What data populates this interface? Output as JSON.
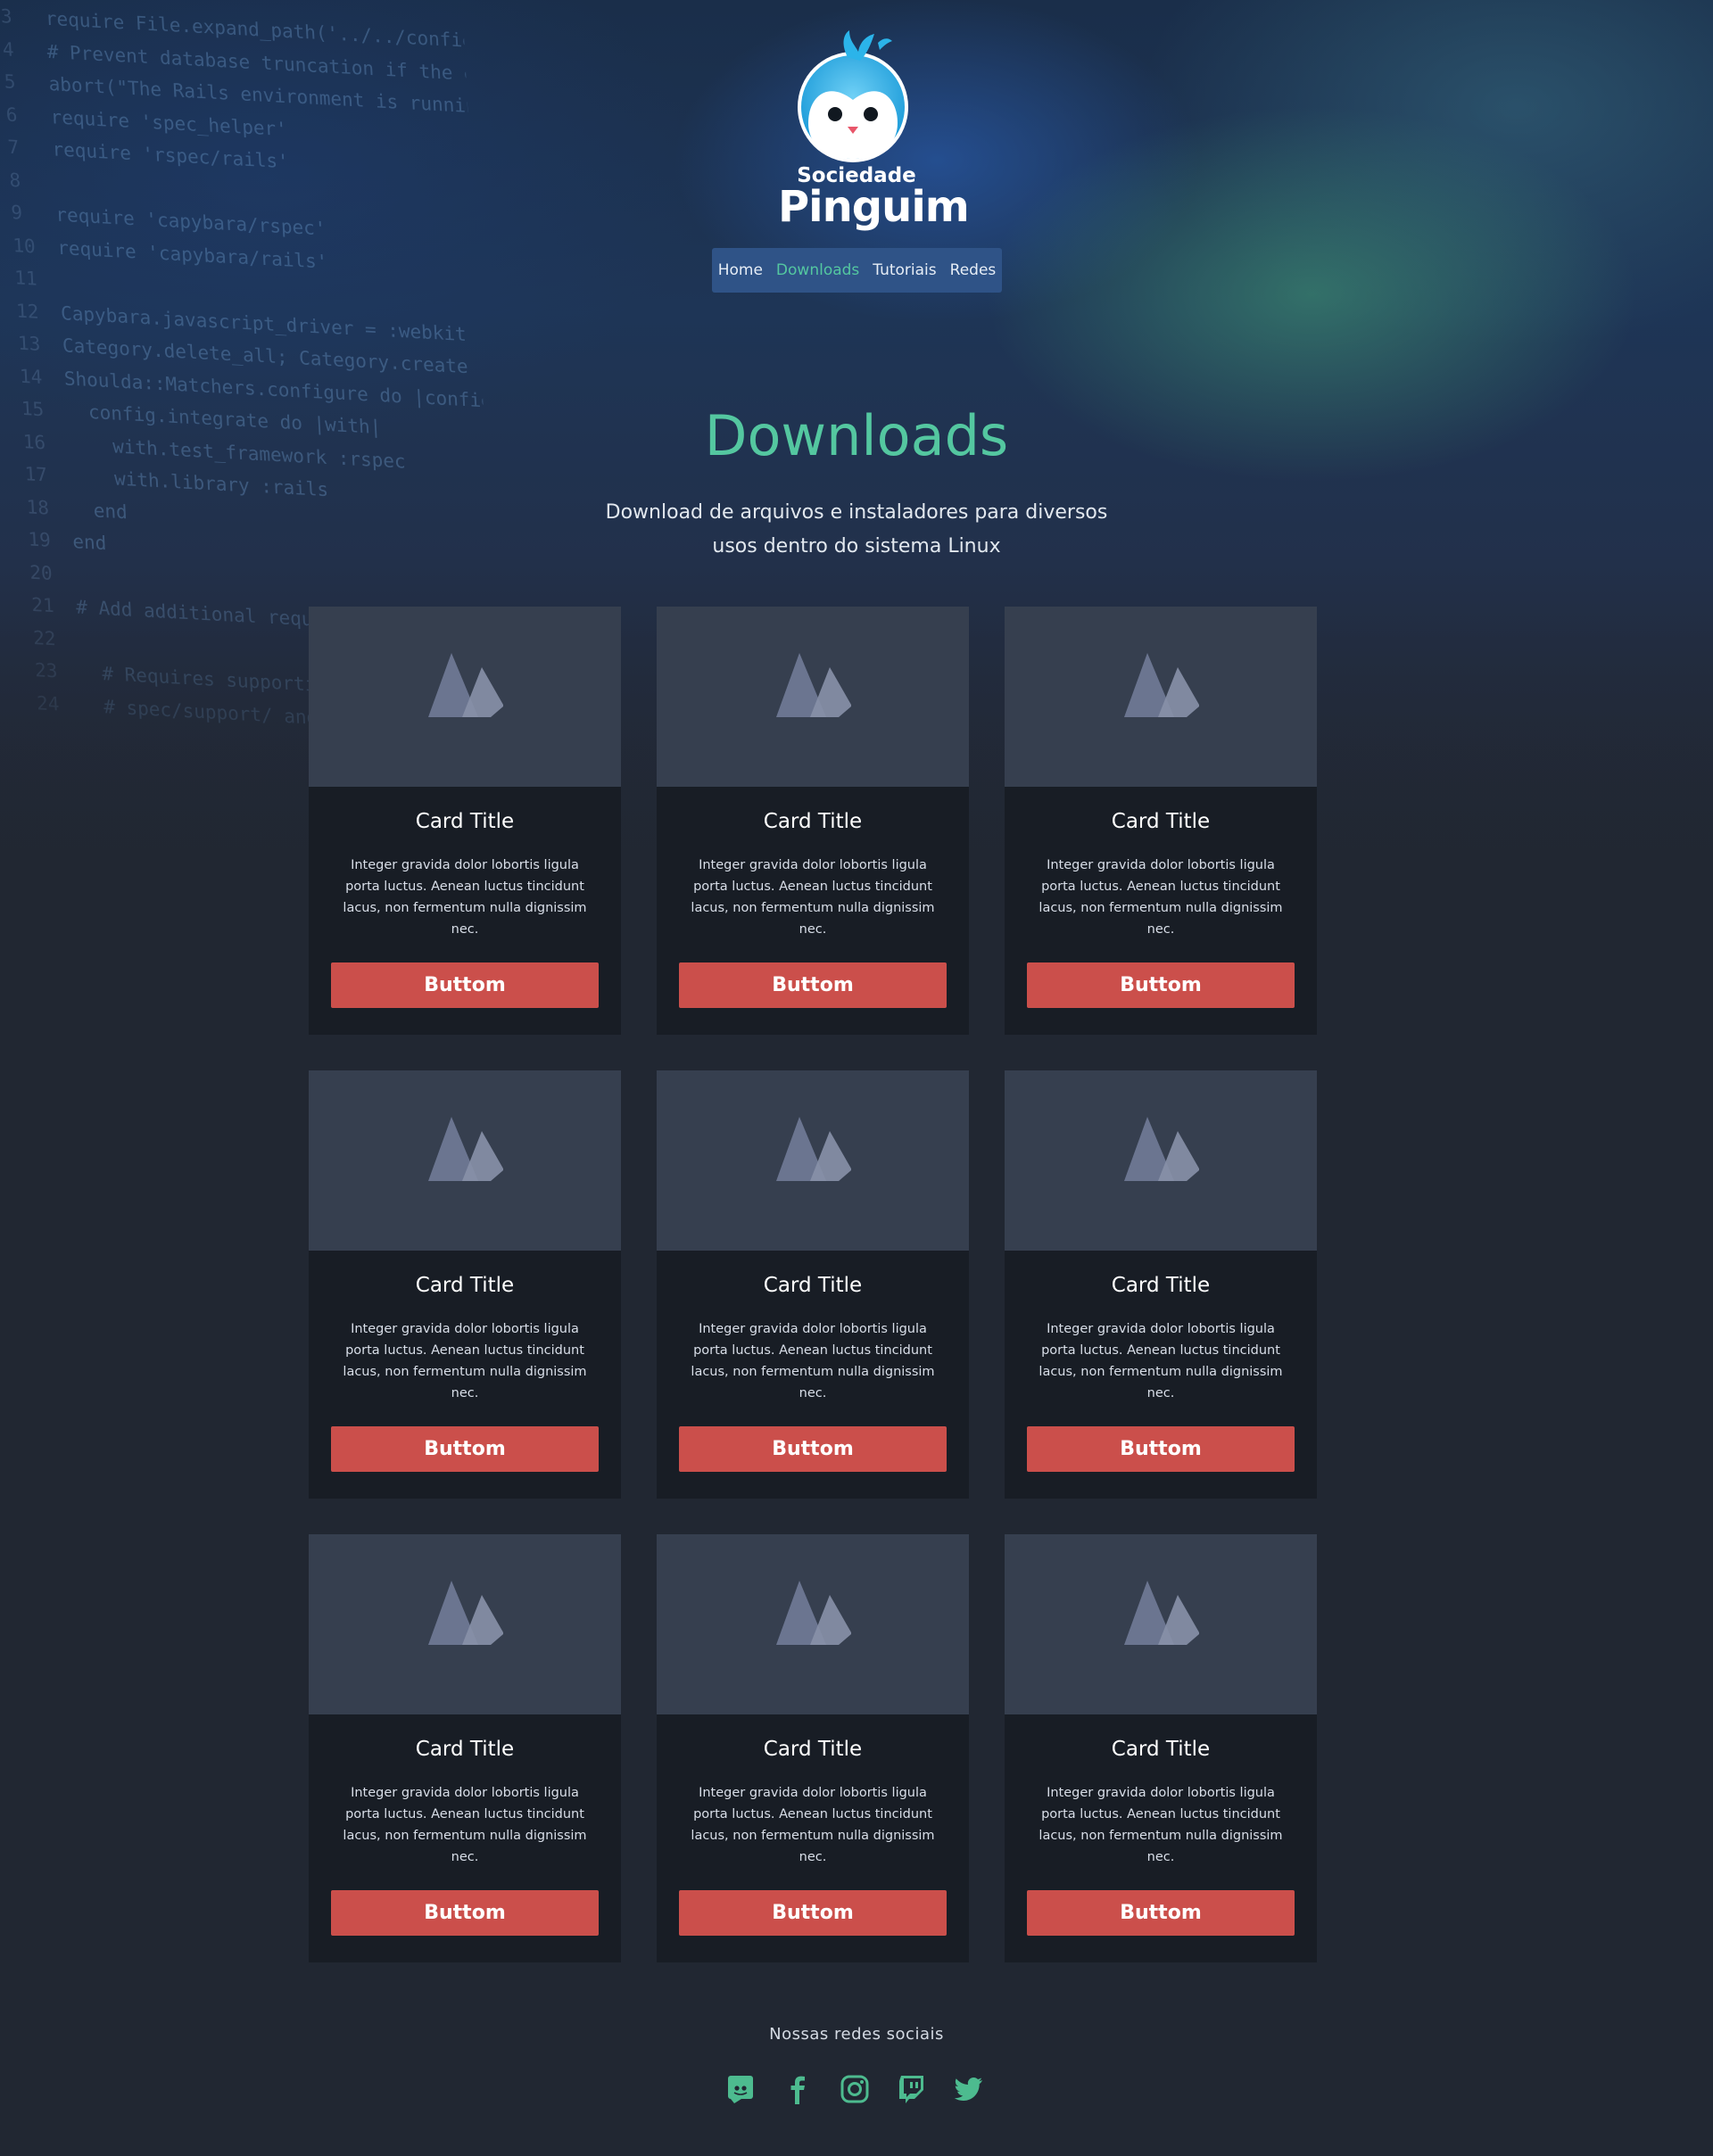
{
  "brand": {
    "line1": "Sociedade",
    "line2": "Pinguim"
  },
  "nav": {
    "items": [
      {
        "label": "Home",
        "active": false
      },
      {
        "label": "Downloads",
        "active": true
      },
      {
        "label": "Tutoriais",
        "active": false
      },
      {
        "label": "Redes",
        "active": false
      }
    ]
  },
  "hero": {
    "title": "Downloads",
    "subtitle": "Download de arquivos e instaladores para diversos usos dentro do sistema Linux"
  },
  "cards": [
    {
      "title": "Card Title",
      "text": "Integer gravida dolor lobortis ligula porta luctus. Aenean luctus tincidunt lacus, non fermentum nulla dignissim nec.",
      "button": "Buttom",
      "image_icon": "image-placeholder-icon"
    },
    {
      "title": "Card Title",
      "text": "Integer gravida dolor lobortis ligula porta luctus. Aenean luctus tincidunt lacus, non fermentum nulla dignissim nec.",
      "button": "Buttom",
      "image_icon": "image-placeholder-icon"
    },
    {
      "title": "Card Title",
      "text": "Integer gravida dolor lobortis ligula porta luctus. Aenean luctus tincidunt lacus, non fermentum nulla dignissim nec.",
      "button": "Buttom",
      "image_icon": "image-placeholder-icon"
    },
    {
      "title": "Card Title",
      "text": "Integer gravida dolor lobortis ligula porta luctus. Aenean luctus tincidunt lacus, non fermentum nulla dignissim nec.",
      "button": "Buttom",
      "image_icon": "image-placeholder-icon"
    },
    {
      "title": "Card Title",
      "text": "Integer gravida dolor lobortis ligula porta luctus. Aenean luctus tincidunt lacus, non fermentum nulla dignissim nec.",
      "button": "Buttom",
      "image_icon": "image-placeholder-icon"
    },
    {
      "title": "Card Title",
      "text": "Integer gravida dolor lobortis ligula porta luctus. Aenean luctus tincidunt lacus, non fermentum nulla dignissim nec.",
      "button": "Buttom",
      "image_icon": "image-placeholder-icon"
    },
    {
      "title": "Card Title",
      "text": "Integer gravida dolor lobortis ligula porta luctus. Aenean luctus tincidunt lacus, non fermentum nulla dignissim nec.",
      "button": "Buttom",
      "image_icon": "image-placeholder-icon"
    },
    {
      "title": "Card Title",
      "text": "Integer gravida dolor lobortis ligula porta luctus. Aenean luctus tincidunt lacus, non fermentum nulla dignissim nec.",
      "button": "Buttom",
      "image_icon": "image-placeholder-icon"
    },
    {
      "title": "Card Title",
      "text": "Integer gravida dolor lobortis ligula porta luctus. Aenean luctus tincidunt lacus, non fermentum nulla dignissim nec.",
      "button": "Buttom",
      "image_icon": "image-placeholder-icon"
    }
  ],
  "footer": {
    "label": "Nossas redes sociais",
    "socials": [
      "discord-icon",
      "facebook-icon",
      "instagram-icon",
      "twitch-icon",
      "twitter-icon"
    ]
  },
  "colors": {
    "accent": "#54c7a0",
    "button": "#cb4f4b",
    "nav_bg": "#2f5387",
    "card_bg": "#181d25",
    "card_image_bg": "#363f4f",
    "page_bg": "#212732"
  },
  "background_code": [
    {
      "n": "3",
      "t": "require File.expand_path('../../config/environment', __FILE__)"
    },
    {
      "n": "4",
      "t": "# Prevent database truncation if the environment is production"
    },
    {
      "n": "5",
      "t": "abort(\"The Rails environment is running in production mode!\")"
    },
    {
      "n": "6",
      "t": "require 'spec_helper'"
    },
    {
      "n": "7",
      "t": "require 'rspec/rails'"
    },
    {
      "n": "8",
      "t": ""
    },
    {
      "n": "9",
      "t": "require 'capybara/rspec'"
    },
    {
      "n": "10",
      "t": "require 'capybara/rails'"
    },
    {
      "n": "11",
      "t": ""
    },
    {
      "n": "12",
      "t": "Capybara.javascript_driver = :webkit"
    },
    {
      "n": "13",
      "t": "Category.delete_all; Category.create"
    },
    {
      "n": "14",
      "t": "Shoulda::Matchers.configure do |config|"
    },
    {
      "n": "15",
      "t": "  config.integrate do |with|"
    },
    {
      "n": "16",
      "t": "    with.test_framework :rspec"
    },
    {
      "n": "17",
      "t": "    with.library :rails"
    },
    {
      "n": "18",
      "t": "  end"
    },
    {
      "n": "19",
      "t": "end"
    },
    {
      "n": "20",
      "t": ""
    },
    {
      "n": "21",
      "t": "# Add additional requires below this line."
    },
    {
      "n": "22",
      "t": ""
    },
    {
      "n": "23",
      "t": "  # Requires supporting ruby files"
    },
    {
      "n": "24",
      "t": "  # spec/support/ and its subdirectories"
    }
  ]
}
